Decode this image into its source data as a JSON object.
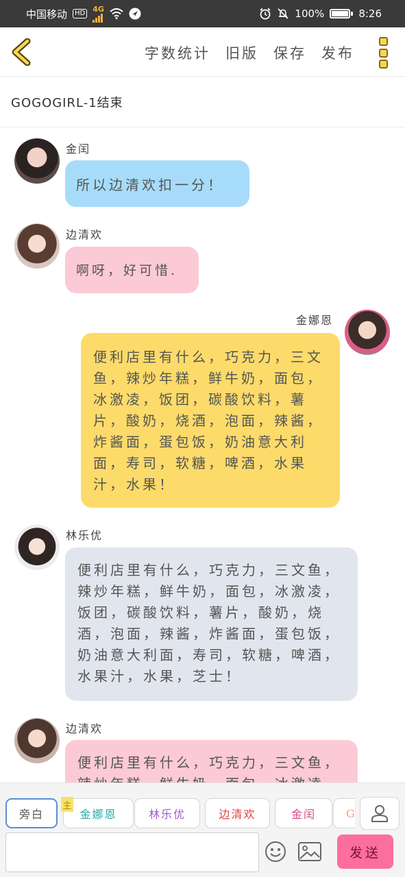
{
  "status_bar": {
    "carrier": "中国移动",
    "hd_badge": "HD",
    "network": "4G",
    "battery_percent": "100%",
    "time": "8:26"
  },
  "toolbar": {
    "links": [
      "字数统计",
      "旧版",
      "保存",
      "发布"
    ]
  },
  "chapter_title": "GOGOGIRL-1结束",
  "messages": [
    {
      "side": "left",
      "name": "金闰",
      "text": "所以边清欢扣一分！",
      "color": "#a6dcf9"
    },
    {
      "side": "left",
      "name": "边清欢",
      "text": "啊呀，好可惜.",
      "color": "#fccad6"
    },
    {
      "side": "right",
      "name": "金娜恩",
      "text": "便利店里有什么，巧克力，三文鱼，辣炒年糕，鲜牛奶，面包，冰激凌，饭团，碳酸饮料，薯片，酸奶，烧酒，泡面，辣酱，炸酱面，蛋包饭，奶油意大利面，寿司，软糖，啤酒，水果汁，水果！",
      "color": "#fcdb6a"
    },
    {
      "side": "left",
      "name": "林乐优",
      "text": "便利店里有什么，巧克力，三文鱼，辣炒年糕，鲜牛奶，面包，冰激凌，饭团，碳酸饮料，薯片，酸奶，烧酒，泡面，辣酱，炸酱面，蛋包饭，奶油意大利面，寿司，软糖，啤酒，水果汁，水果，芝士！",
      "color": "#e1e6ee"
    },
    {
      "side": "left",
      "name": "边清欢",
      "text": "便利店里有什么，巧克力，三文鱼，辣炒年糕，鲜牛奶，面包，冰激凌，",
      "color": "#fccad6"
    }
  ],
  "role_chips": [
    {
      "label": "旁白",
      "color": "#555555"
    },
    {
      "label": "金娜恩",
      "color": "#2aa7a7",
      "tag": "主"
    },
    {
      "label": "林乐优",
      "color": "#a25ad4"
    },
    {
      "label": "边清欢",
      "color": "#e0423a"
    },
    {
      "label": "金闰",
      "color": "#d44a8a"
    },
    {
      "label": "GIF",
      "color": "#f0a57a"
    }
  ],
  "input": {
    "placeholder": "",
    "value": ""
  },
  "send_label": "发送"
}
